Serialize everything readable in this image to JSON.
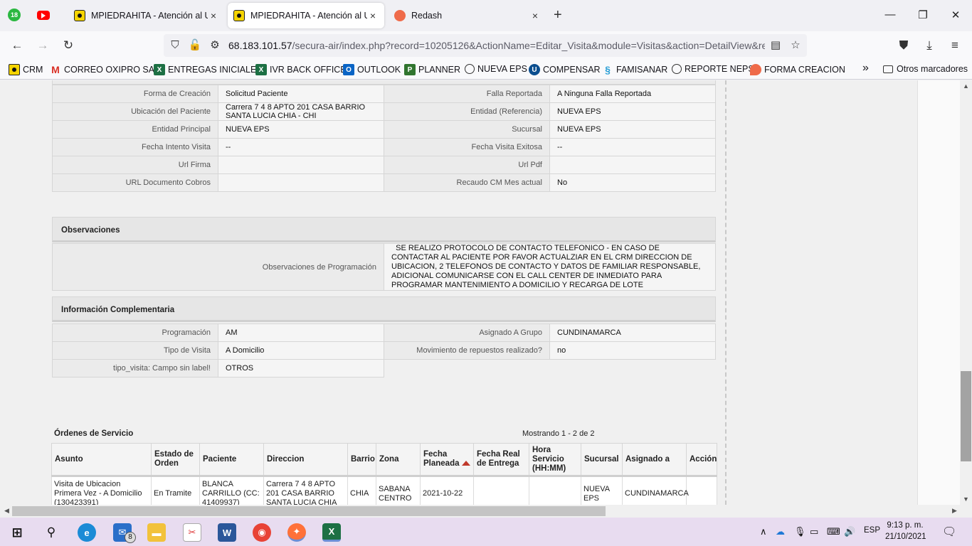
{
  "browser": {
    "pinned_badge": "18",
    "tabs": [
      {
        "title": "MPIEDRAHITA - Atención al Usuario",
        "close": "×"
      },
      {
        "title": "MPIEDRAHITA - Atención al Usuario",
        "close": "×"
      },
      {
        "title": "Redash",
        "close": "×"
      }
    ],
    "new_tab": "+",
    "window_controls": {
      "minimize": "—",
      "restore": "❐",
      "close": "✕"
    },
    "url_host": "68.183.101.57",
    "url_path": "/secura-air/index.php?record=10205126&ActionName=Editar_Visita&module=Visitas&action=DetailView&record=",
    "nav": {
      "back": "←",
      "forward": "→",
      "reload": "↻"
    },
    "bookmarks": [
      {
        "label": "CRM",
        "icon": "yellow-logo-icon"
      },
      {
        "label": "CORREO OXIPRO SAS",
        "icon": "gmail-icon"
      },
      {
        "label": "ENTREGAS INICIALES",
        "icon": "excel-icon"
      },
      {
        "label": "IVR BACK OFFICE",
        "icon": "excel-icon"
      },
      {
        "label": "OUTLOOK",
        "icon": "outlook-icon"
      },
      {
        "label": "PLANNER",
        "icon": "planner-icon"
      },
      {
        "label": "NUEVA EPS",
        "icon": "globe-icon"
      },
      {
        "label": "COMPENSAR",
        "icon": "compensar-icon"
      },
      {
        "label": "FAMISANAR",
        "icon": "famisanar-icon"
      },
      {
        "label": "REPORTE NEPS",
        "icon": "globe-icon"
      },
      {
        "label": "FORMA CREACION",
        "icon": "redash-icon"
      }
    ],
    "bookmarks_overflow": "»",
    "other_bookmarks": "Otros marcadores"
  },
  "detail_rows": [
    {
      "l1": "Forma de Creación",
      "v1": "Solicitud Paciente",
      "l2": "Falla Reportada",
      "v2": "A Ninguna Falla Reportada"
    },
    {
      "l1": "Ubicación del Paciente",
      "v1": "Carrera 7 4 8 APTO 201 CASA BARRIO SANTA LUCIA CHIA - CHI",
      "l2": "Entidad (Referencia)",
      "v2": "NUEVA EPS"
    },
    {
      "l1": "Entidad Principal",
      "v1": "NUEVA EPS",
      "l2": "Sucursal",
      "v2": "NUEVA EPS"
    },
    {
      "l1": "Fecha Intento Visita",
      "v1": " --",
      "l2": "Fecha Visita Exitosa",
      "v2": " --"
    },
    {
      "l1": "Url Firma",
      "v1": "",
      "l2": "Url Pdf",
      "v2": ""
    },
    {
      "l1": "URL Documento Cobros",
      "v1": "",
      "l2": "Recaudo CM Mes actual",
      "v2": "No"
    }
  ],
  "observaciones": {
    "title": "Observaciones",
    "label": "Observaciones de Programación",
    "value": "  SE REALIZO PROTOCOLO DE CONTACTO TELEFONICO - EN CASO DE CONTACTAR AL PACIENTE POR FAVOR ACTUALZIAR EN EL CRM DIRECCION DE UBICACION, 2 TELEFONOS DE CONTACTO Y DATOS DE FAMILIAR RESPONSABLE, ADICIONAL COMUNICARSE CON EL CALL CENTER DE INMEDIATO PARA PROGRAMAR MANTENIMIENTO A DOMICILIO Y RECARGA DE LOTE"
  },
  "complementaria": {
    "title": "Información Complementaria",
    "rows": [
      {
        "l1": "Programación",
        "v1": "AM",
        "l2": "Asignado A Grupo",
        "v2": "CUNDINAMARCA"
      },
      {
        "l1": "Tipo de Visita",
        "v1": "A Domicilio",
        "l2": "Movimiento de repuestos realizado?",
        "v2": " no"
      }
    ],
    "last_label": "tipo_visita: Campo sin label!",
    "last_value": "OTROS"
  },
  "ordenes": {
    "title": "Órdenes de Servicio",
    "count": "Mostrando 1 - 2 de 2",
    "headers": {
      "asunto": "Asunto",
      "estado": "Estado de Orden",
      "paciente": "Paciente",
      "direccion": "Direccion",
      "barrio": "Barrio",
      "zona": "Zona",
      "fecha_planeada": "Fecha Planeada",
      "fecha_real": "Fecha Real de Entrega",
      "hora": "Hora Servicio (HH:MM)",
      "sucursal": "Sucursal",
      "asignado": "Asignado a",
      "accion": "Acción"
    },
    "rows": [
      {
        "asunto": "Visita de Ubicacion Primera Vez - A Domicilio (130423391)",
        "estado": "En Tramite",
        "paciente": "BLANCA CARRILLO (CC: 41409937)",
        "direccion": "Carrera 7 4 8 APTO 201 CASA BARRIO SANTA LUCIA CHIA",
        "barrio": "CHIA",
        "zona": "SABANA CENTRO",
        "fecha_planeada": "2021-10-22",
        "fecha_real": "",
        "hora": "",
        "sucursal": "NUEVA EPS",
        "asignado": "CUNDINAMARCA",
        "accion": ""
      }
    ]
  },
  "taskbar": {
    "mail_badge": "8",
    "language": "ESP",
    "time": "9:13 p. m.",
    "date": "21/10/2021"
  }
}
